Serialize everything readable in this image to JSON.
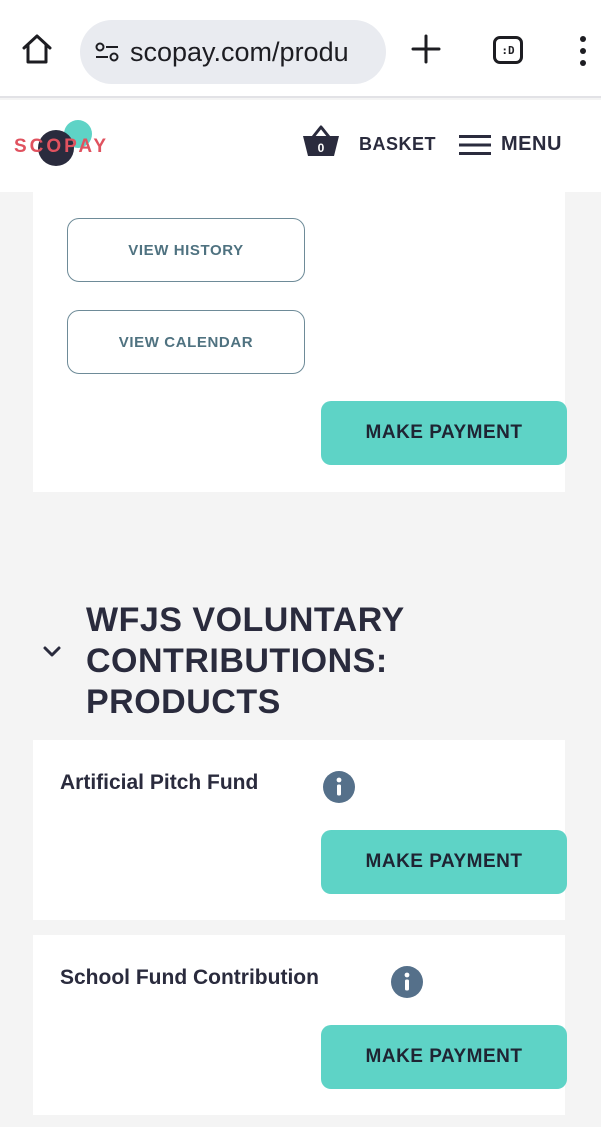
{
  "browser": {
    "url": "scopay.com/produ",
    "tabs_badge": ":D",
    "icons": [
      "home-icon",
      "site-settings-icon",
      "new-tab-icon",
      "tabs-icon",
      "more-options-icon"
    ]
  },
  "header": {
    "logo_text": "SCOPAY",
    "basket_count": "0",
    "basket_label": "BASKET",
    "menu_label": "MENU"
  },
  "top_card": {
    "view_history_label": "VIEW HISTORY",
    "view_calendar_label": "VIEW CALENDAR",
    "make_payment_label": "MAKE PAYMENT"
  },
  "section": {
    "title": "WFJS VOLUNTARY CONTRIBUTIONS: PRODUCTS"
  },
  "products": [
    {
      "name": "Artificial Pitch Fund",
      "make_payment_label": "MAKE PAYMENT"
    },
    {
      "name": "School Fund Contribution",
      "make_payment_label": "MAKE PAYMENT"
    }
  ],
  "colors": {
    "accent_teal": "#5ed3c6",
    "logo_red": "#e0525f",
    "logo_dark": "#2a2b3d",
    "outline_button": "#6e8b98",
    "info_icon": "#55708a"
  }
}
